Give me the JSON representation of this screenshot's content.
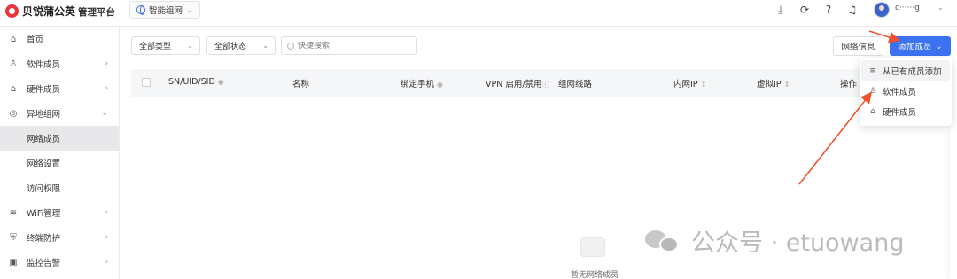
{
  "brand": {
    "name": "贝锐蒲公英",
    "platform": "管理平台"
  },
  "space_selector": {
    "label": "智能组网"
  },
  "header_icons": [
    "download-icon",
    "headset-icon",
    "help-icon",
    "bell-icon",
    "grid-icon"
  ],
  "user": {
    "name": "c······g"
  },
  "sidebar": {
    "items": [
      {
        "label": "首页",
        "icon": "home-icon"
      },
      {
        "label": "软件成员",
        "icon": "user-icon",
        "arrow": "›"
      },
      {
        "label": "硬件成员",
        "icon": "device-icon",
        "arrow": "›"
      },
      {
        "label": "异地组网",
        "icon": "network-icon",
        "arrow": "⌄"
      }
    ],
    "sub_items": [
      {
        "label": "网络成员",
        "active": true
      },
      {
        "label": "网络设置"
      },
      {
        "label": "访问权限"
      }
    ],
    "items_after": [
      {
        "label": "WiFi管理",
        "icon": "wifi-icon",
        "arrow": "›"
      },
      {
        "label": "终端防护",
        "icon": "shield-icon",
        "arrow": "›"
      },
      {
        "label": "监控告警",
        "icon": "monitor-icon",
        "arrow": "›"
      }
    ]
  },
  "filters": {
    "type": "全部类型",
    "status": "全部状态",
    "search_placeholder": "快捷搜索"
  },
  "buttons": {
    "network_info": "网络信息",
    "add_member": "添加成员"
  },
  "table": {
    "columns": [
      "SN/UID/SID",
      "名称",
      "绑定手机",
      "VPN 启用/禁用",
      "组网线路",
      "内网IP",
      "虚拟IP",
      "操作"
    ]
  },
  "empty": {
    "text": "暂无网络成员"
  },
  "add_menu": {
    "items": [
      {
        "label": "从已有成员添加",
        "icon": "list-add-icon"
      },
      {
        "label": "软件成员",
        "icon": "user-icon"
      },
      {
        "label": "硬件成员",
        "icon": "device-icon"
      }
    ]
  },
  "watermark": {
    "text": "公众号 · etuowang"
  },
  "colors": {
    "primary": "#3b72f0",
    "annotation": "#f0522d",
    "brand": "#e8343a"
  }
}
